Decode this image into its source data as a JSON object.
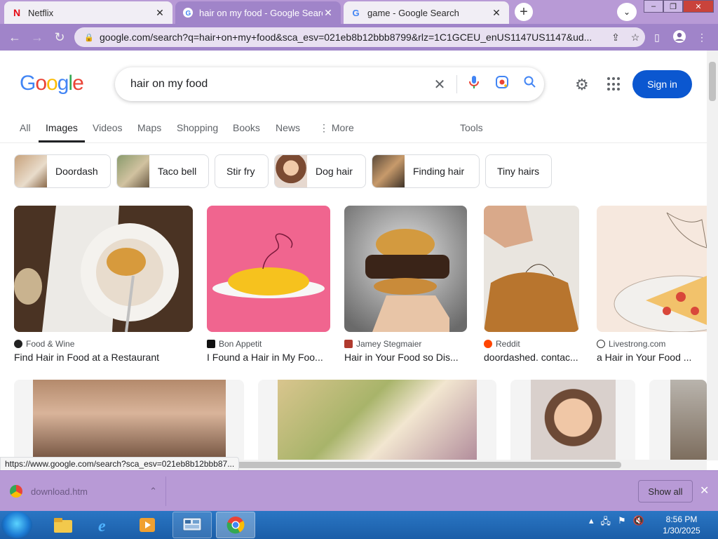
{
  "browser": {
    "tabs": [
      {
        "title": "Netflix",
        "favicon": "netflix-icon",
        "active": false
      },
      {
        "title": "hair on my food - Google Search",
        "favicon": "google-icon",
        "active": true
      },
      {
        "title": "game - Google Search",
        "favicon": "google-icon",
        "active": false
      }
    ],
    "url": "google.com/search?q=hair+on+my+food&sca_esv=021eb8b12bbb8799&rlz=1C1GCEU_enUS1147US1147&ud..."
  },
  "google": {
    "query": "hair on my food",
    "sign_in": "Sign in",
    "nav": [
      {
        "label": "All"
      },
      {
        "label": "Images",
        "active": true
      },
      {
        "label": "Videos"
      },
      {
        "label": "Maps"
      },
      {
        "label": "Shopping"
      },
      {
        "label": "Books"
      },
      {
        "label": "News"
      },
      {
        "label": "More"
      }
    ],
    "tools": "Tools",
    "chips": [
      {
        "label": "Doordash"
      },
      {
        "label": "Taco bell"
      },
      {
        "label": "Stir fry"
      },
      {
        "label": "Dog hair"
      },
      {
        "label": "Finding hair"
      },
      {
        "label": "Tiny hairs"
      }
    ],
    "results": [
      {
        "source": "Food & Wine",
        "caption": "Find Hair in Food at a Restaurant"
      },
      {
        "source": "Bon Appetit",
        "caption": "I Found a Hair in My Foo..."
      },
      {
        "source": "Jamey Stegmaier",
        "caption": "Hair in Your Food so Dis..."
      },
      {
        "source": "Reddit",
        "caption": "doordashed. contac..."
      },
      {
        "source": "Livestrong.com",
        "caption": "a Hair in Your Food ..."
      }
    ]
  },
  "status_url": "https://www.google.com/search?sca_esv=021eb8b12bbb87...",
  "downloads": {
    "file": "download.htm",
    "show_all": "Show all"
  },
  "taskbar": {
    "time": "8:56 PM",
    "date": "1/30/2025"
  }
}
